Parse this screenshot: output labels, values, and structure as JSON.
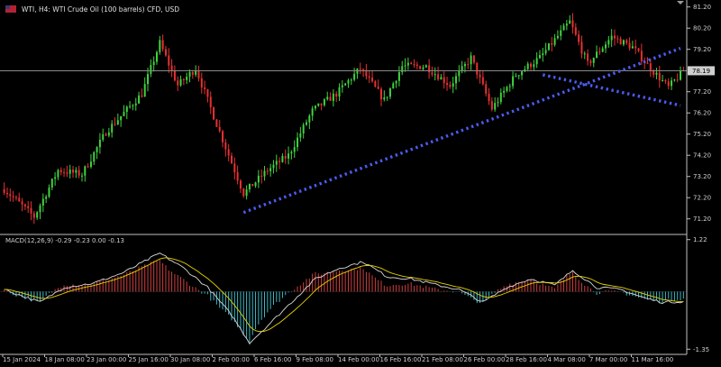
{
  "header": {
    "title": "WTI, H4:  WTI Crude Oil (100 barrels) CFD, USD",
    "flag_colors": [
      "#b22234",
      "#ffffff",
      "#3c3b6e"
    ]
  },
  "macd_label": "MACD(12,26,9) -0.29 -0.23 0.00 -0.13",
  "colors": {
    "background": "#000000",
    "bull": "#3fd23f",
    "bear": "#e83030",
    "trendline": "#4a5cf0",
    "price_line": "#8a8a8a",
    "macd_line": "#d8d8d8",
    "signal_line": "#e6d200",
    "hist_pos": "#d04040",
    "hist_neg": "#3fb8c4"
  },
  "chart_data": [
    {
      "type": "candlestick",
      "name": "WTI H4",
      "ylim": [
        70.55,
        81.4
      ],
      "y_ticks": [
        81.2,
        80.2,
        79.2,
        77.2,
        76.2,
        75.2,
        74.2,
        73.2,
        72.2,
        71.2
      ],
      "current_price": 78.19,
      "bar_count": 228,
      "anchors": [
        [
          0,
          72.6
        ],
        [
          10,
          71.3
        ],
        [
          18,
          73.5
        ],
        [
          26,
          73.3
        ],
        [
          34,
          75.3
        ],
        [
          46,
          77.1
        ],
        [
          52,
          79.5
        ],
        [
          58,
          77.5
        ],
        [
          64,
          78.3
        ],
        [
          72,
          75.3
        ],
        [
          80,
          72.4
        ],
        [
          88,
          73.5
        ],
        [
          95,
          74.2
        ],
        [
          103,
          76.3
        ],
        [
          111,
          77.1
        ],
        [
          119,
          78.3
        ],
        [
          127,
          76.8
        ],
        [
          133,
          78.4
        ],
        [
          141,
          78.4
        ],
        [
          149,
          77.5
        ],
        [
          156,
          78.8
        ],
        [
          163,
          76.4
        ],
        [
          171,
          78.0
        ],
        [
          179,
          78.8
        ],
        [
          189,
          80.5
        ],
        [
          195,
          78.5
        ],
        [
          203,
          79.8
        ],
        [
          210,
          79.3
        ],
        [
          216,
          78.3
        ],
        [
          222,
          77.4
        ],
        [
          227,
          78.19
        ]
      ],
      "x_tick_labels": [
        "15 Jan 2024",
        "18 Jan 08:00",
        "23 Jan 00:00",
        "25 Jan 16:00",
        "30 Jan 08:00",
        "2 Feb 00:00",
        "6 Feb 16:00",
        "9 Feb 08:00",
        "14 Feb 00:00",
        "16 Feb 16:00",
        "21 Feb 08:00",
        "26 Feb 00:00",
        "28 Feb 16:00",
        "4 Mar 08:00",
        "7 Mar 00:00",
        "11 Mar 16:00"
      ],
      "trendlines": [
        {
          "name": "ascending-support",
          "from": [
            80,
            71.5
          ],
          "to": [
            226,
            79.25
          ]
        },
        {
          "name": "descending-resistance",
          "from": [
            180,
            78.0
          ],
          "to": [
            226,
            76.55
          ]
        }
      ]
    },
    {
      "type": "macd",
      "name": "MACD(12,26,9)",
      "ylim": [
        -1.45,
        1.32
      ],
      "y_ticks": [
        1.22,
        -1.35
      ],
      "anchors": [
        [
          0,
          0.05
        ],
        [
          12,
          -0.25
        ],
        [
          20,
          0.1
        ],
        [
          30,
          0.2
        ],
        [
          40,
          0.45
        ],
        [
          52,
          0.9
        ],
        [
          60,
          0.55
        ],
        [
          68,
          0.1
        ],
        [
          76,
          -0.55
        ],
        [
          82,
          -1.2
        ],
        [
          88,
          -0.8
        ],
        [
          96,
          -0.25
        ],
        [
          104,
          0.3
        ],
        [
          112,
          0.55
        ],
        [
          120,
          0.7
        ],
        [
          128,
          0.35
        ],
        [
          136,
          0.3
        ],
        [
          145,
          0.15
        ],
        [
          152,
          0.05
        ],
        [
          160,
          -0.25
        ],
        [
          168,
          0.1
        ],
        [
          176,
          0.3
        ],
        [
          184,
          0.15
        ],
        [
          190,
          0.5
        ],
        [
          198,
          0.1
        ],
        [
          206,
          0.05
        ],
        [
          214,
          -0.15
        ],
        [
          220,
          -0.25
        ],
        [
          227,
          -0.23
        ]
      ]
    }
  ]
}
